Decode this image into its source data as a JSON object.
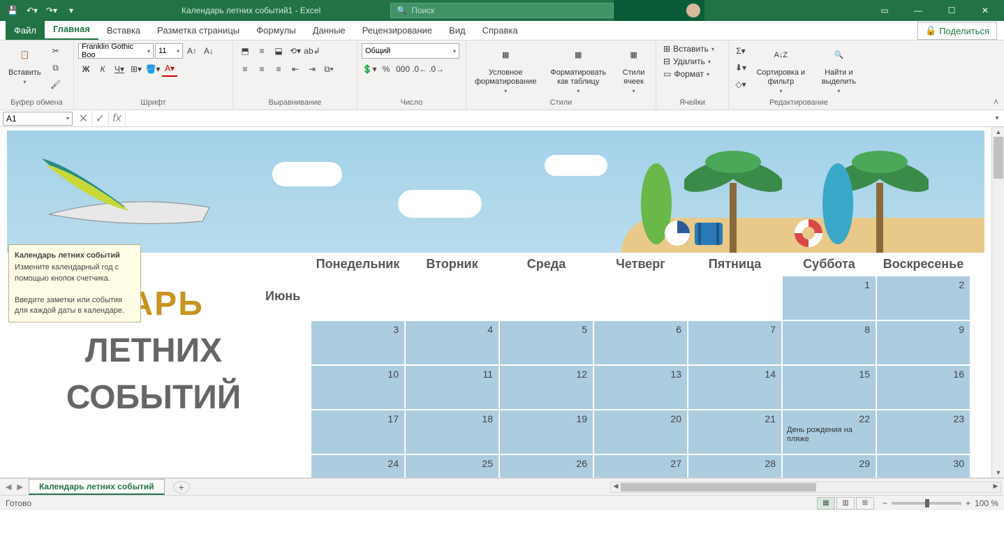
{
  "titlebar": {
    "doc_title": "Календарь летних событий1  -  Excel",
    "search_placeholder": "Поиск"
  },
  "tabs": {
    "file": "Файл",
    "items": [
      "Главная",
      "Вставка",
      "Разметка страницы",
      "Формулы",
      "Данные",
      "Рецензирование",
      "Вид",
      "Справка"
    ],
    "active_index": 0,
    "share": "Поделиться"
  },
  "ribbon": {
    "clipboard": {
      "label": "Буфер обмена",
      "paste": "Вставить"
    },
    "font": {
      "label": "Шрифт",
      "name": "Franklin Gothic Boo",
      "size": "11",
      "bold": "Ж",
      "italic": "К",
      "underline": "Ч"
    },
    "alignment": {
      "label": "Выравнивание"
    },
    "number": {
      "label": "Число",
      "format": "Общий"
    },
    "styles": {
      "label": "Стили",
      "cond": "Условное форматирование",
      "table": "Форматировать как таблицу",
      "cell": "Стили ячеек"
    },
    "cells": {
      "label": "Ячейки",
      "insert": "Вставить",
      "delete": "Удалить",
      "format": "Формат"
    },
    "editing": {
      "label": "Редактирование",
      "sort": "Сортировка и фильтр",
      "find": "Найти и выделить"
    }
  },
  "formula_bar": {
    "cell_ref": "A1",
    "formula": ""
  },
  "tooltip": {
    "title": "Календарь летних событий",
    "line1": "Измените календарный год с помощью кнопок счетчика.",
    "line2": "Введите заметки или события для каждой даты в календаре."
  },
  "calendar": {
    "title_part1": "ДАРЬ",
    "title_line2": "ЛЕТНИХ",
    "title_line3": "СОБЫТИЙ",
    "month": "Июнь",
    "days": [
      "Понедельник",
      "Вторник",
      "Среда",
      "Четверг",
      "Пятница",
      "Суббота",
      "Воскресенье"
    ],
    "rows": [
      [
        null,
        null,
        null,
        null,
        null,
        1,
        2
      ],
      [
        3,
        4,
        5,
        6,
        7,
        8,
        9
      ],
      [
        10,
        11,
        12,
        13,
        14,
        15,
        16
      ],
      [
        17,
        18,
        19,
        20,
        21,
        22,
        23
      ],
      [
        24,
        25,
        26,
        27,
        28,
        29,
        30
      ]
    ],
    "event": {
      "row": 3,
      "col": 5,
      "text": "День рождения на пляже"
    }
  },
  "sheet_tab": "Календарь летних событий",
  "statusbar": {
    "ready": "Готово",
    "zoom": "100 %"
  }
}
